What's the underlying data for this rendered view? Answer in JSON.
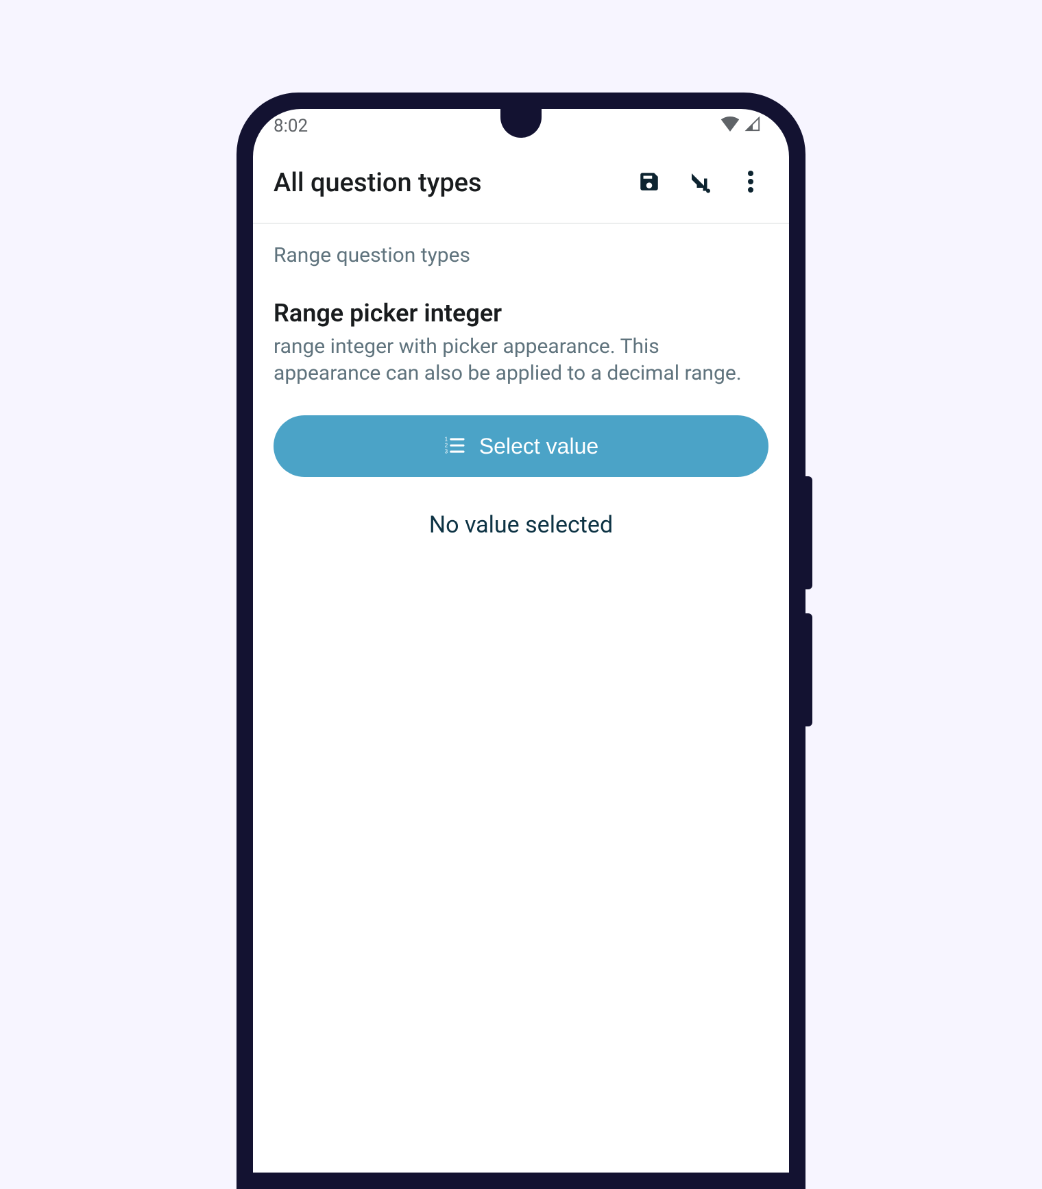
{
  "status": {
    "time": "8:02"
  },
  "appbar": {
    "title": "All question types"
  },
  "content": {
    "group_label": "Range question types",
    "question_title": "Range picker integer",
    "question_desc": "range integer with picker appearance. This appearance can also be applied to a decimal range.",
    "select_button_label": "Select value",
    "no_value_text": "No value selected"
  },
  "colors": {
    "accent": "#4ba3c7",
    "dark": "#0d2430"
  }
}
